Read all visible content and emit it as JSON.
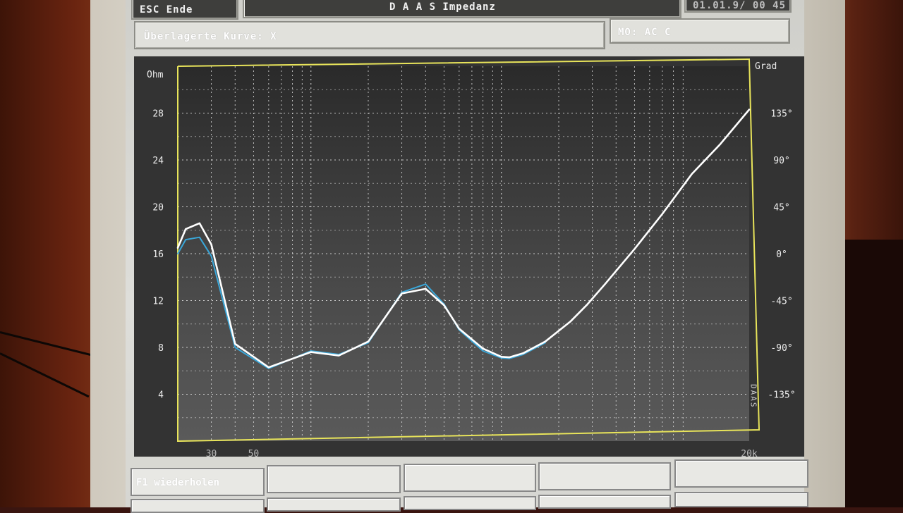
{
  "header": {
    "esc_label": "ESC Ende",
    "title": "D A A S  Impedanz",
    "datetime": "01.01.9/   00 45"
  },
  "infobar": {
    "overlay_label": "Überlagerte Kurve: X",
    "mode_label": "MO: AC C"
  },
  "function_keys": {
    "f1_label": "F1 wiederholen",
    "f2_label": "",
    "f3_label": "",
    "f4_label": "",
    "f5_label": ""
  },
  "colors": {
    "plot_bg": "#3a3a3a",
    "frame": "#e8e45a",
    "grid": "#d8d8d8",
    "curve_current": "#ffffff",
    "curve_overlay": "#3aa7d9"
  },
  "chart_data": {
    "type": "line",
    "title": "",
    "y_left_label": "Ohm",
    "y_right_label": "Grad",
    "ylim": [
      0,
      32
    ],
    "y_right_lim": [
      -180,
      180
    ],
    "xlim": [
      20,
      20000
    ],
    "x_scale": "log",
    "grid": true,
    "y_ticks": [
      "28",
      "24",
      "20",
      "16",
      "12",
      "8",
      "4"
    ],
    "y_tick_values": [
      28,
      24,
      20,
      16,
      12,
      8,
      4
    ],
    "y_right_ticks": [
      "135°",
      "90°",
      "45°",
      "0°",
      "-45°",
      "-90°",
      "-135°"
    ],
    "y_right_tick_values": [
      135,
      90,
      45,
      0,
      -45,
      -90,
      -135
    ],
    "x_tick_labels": [
      "30",
      "50",
      "20k"
    ],
    "x_tick_values": [
      30,
      50,
      20000
    ],
    "vertical_text": "DAAS",
    "series": [
      {
        "role": "current",
        "x": [
          20,
          22,
          26,
          30,
          40,
          60,
          100,
          140,
          200,
          300,
          400,
          500,
          600,
          800,
          1000,
          1100,
          1300,
          1700,
          2300,
          2800,
          3500,
          5000,
          7000,
          10000,
          14000,
          20000
        ],
        "values": [
          16.5,
          18.1,
          18.6,
          16.8,
          8.3,
          6.3,
          7.6,
          7.3,
          8.5,
          12.6,
          13.0,
          11.6,
          9.6,
          7.9,
          7.2,
          7.15,
          7.5,
          8.5,
          10.2,
          11.6,
          13.4,
          16.4,
          19.4,
          22.8,
          25.3,
          28.3
        ]
      },
      {
        "role": "overlay",
        "x": [
          20,
          22,
          26,
          30,
          40,
          60,
          100,
          140,
          200,
          300,
          400,
          500,
          600,
          800,
          1000,
          1100,
          1300,
          1700
        ],
        "values": [
          16.0,
          17.2,
          17.4,
          15.8,
          8.0,
          6.2,
          7.7,
          7.4,
          8.4,
          12.7,
          13.4,
          11.7,
          9.5,
          7.7,
          7.1,
          7.05,
          7.4,
          8.4
        ]
      }
    ]
  }
}
